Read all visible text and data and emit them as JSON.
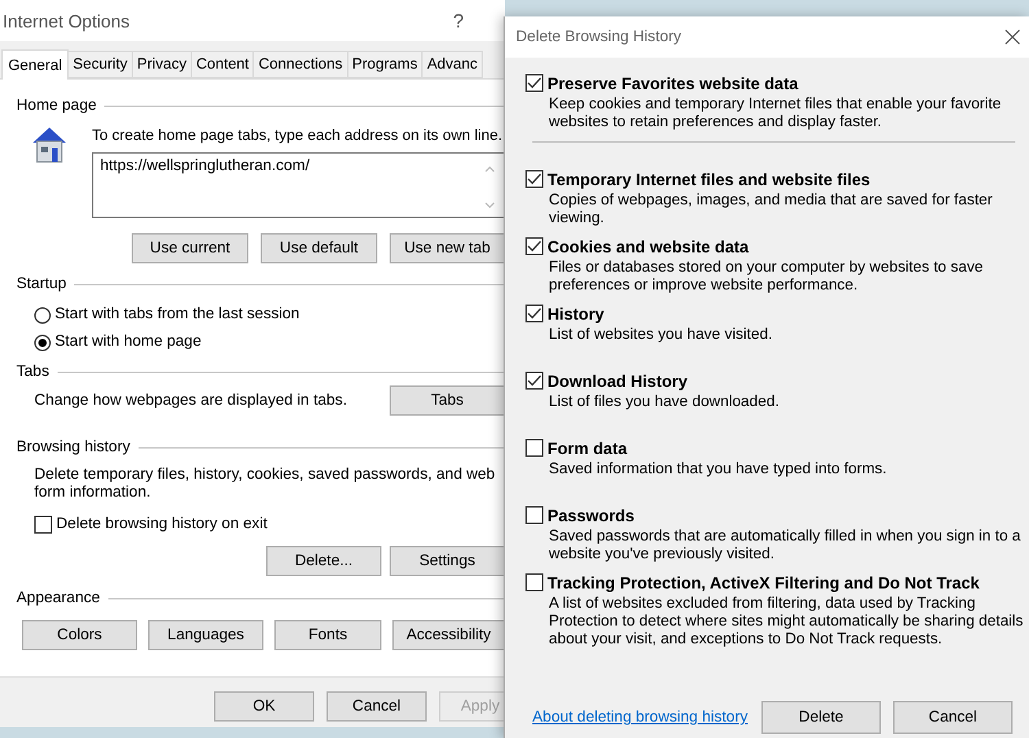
{
  "options_window": {
    "title": "Internet Options",
    "help": "?",
    "tabs": [
      {
        "label": "General",
        "selected": true
      },
      {
        "label": "Security",
        "selected": false
      },
      {
        "label": "Privacy",
        "selected": false
      },
      {
        "label": "Content",
        "selected": false
      },
      {
        "label": "Connections",
        "selected": false
      },
      {
        "label": "Programs",
        "selected": false
      },
      {
        "label": "Advanc",
        "selected": false
      }
    ],
    "home_page": {
      "heading": "Home page",
      "hint": "To create home page tabs, type each address on its own line.",
      "value": "https://wellspringlutheran.com/",
      "buttons": [
        "Use current",
        "Use default",
        "Use new tab"
      ]
    },
    "startup": {
      "heading": "Startup",
      "options": [
        {
          "label": "Start with tabs from the last session",
          "selected": false
        },
        {
          "label": "Start with home page",
          "selected": true
        }
      ]
    },
    "tabs_group": {
      "heading": "Tabs",
      "text": "Change how webpages are displayed in tabs.",
      "button": "Tabs"
    },
    "browsing_history": {
      "heading": "Browsing history",
      "text": "Delete temporary files, history, cookies, saved passwords, and web form information.",
      "delete_on_exit": {
        "label": "Delete browsing history on exit",
        "checked": false
      },
      "buttons": [
        "Delete...",
        "Settings"
      ]
    },
    "appearance": {
      "heading": "Appearance",
      "buttons": [
        "Colors",
        "Languages",
        "Fonts",
        "Accessibility"
      ]
    },
    "footer_buttons": [
      {
        "label": "OK",
        "disabled": false
      },
      {
        "label": "Cancel",
        "disabled": false
      },
      {
        "label": "Apply",
        "disabled": true
      }
    ]
  },
  "delete_dialog": {
    "title": "Delete Browsing History",
    "items": [
      {
        "title": "Preserve Favorites website data",
        "text": "Keep cookies and temporary Internet files that enable your favorite websites to retain preferences and display faster.",
        "checked": true
      },
      {
        "title": "Temporary Internet files and website files",
        "text": "Copies of webpages, images, and media that are saved for faster viewing.",
        "checked": true
      },
      {
        "title": "Cookies and website data",
        "text": "Files or databases stored on your computer by websites to save preferences or improve website performance.",
        "checked": true
      },
      {
        "title": "History",
        "text": "List of websites you have visited.",
        "checked": true
      },
      {
        "title": "Download History",
        "text": "List of files you have downloaded.",
        "checked": true
      },
      {
        "title": "Form data",
        "text": "Saved information that you have typed into forms.",
        "checked": false
      },
      {
        "title": "Passwords",
        "text": "Saved passwords that are automatically filled in when you sign in to a website you've previously visited.",
        "checked": false
      },
      {
        "title": "Tracking Protection, ActiveX Filtering and Do Not Track",
        "text": "A list of websites excluded from filtering, data used by Tracking Protection to detect where sites might automatically be sharing details about your visit, and exceptions to Do Not Track requests.",
        "checked": false
      }
    ],
    "link": "About deleting browsing history",
    "buttons": [
      "Delete",
      "Cancel"
    ]
  }
}
